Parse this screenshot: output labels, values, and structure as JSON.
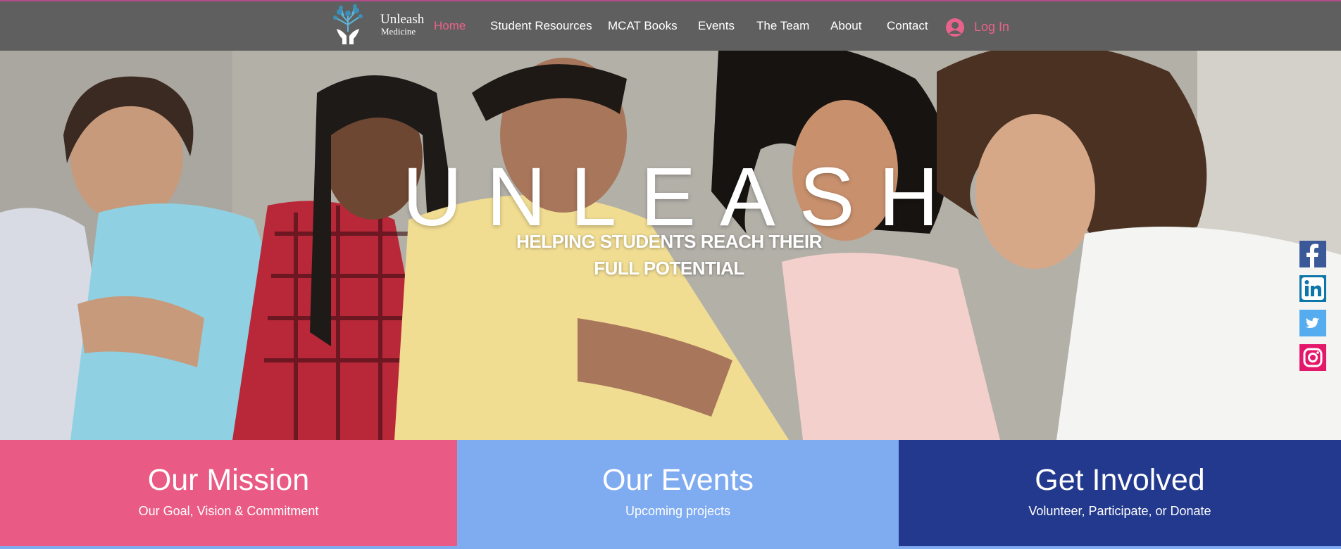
{
  "site": {
    "logo_word": "Unleash",
    "logo_sub": "Medicine"
  },
  "nav": {
    "items": [
      {
        "label": "Home",
        "active": true
      },
      {
        "label": "Student Resources"
      },
      {
        "label": "MCAT Books"
      },
      {
        "label": "Events"
      },
      {
        "label": "The Team"
      },
      {
        "label": "About"
      },
      {
        "label": "Contact"
      }
    ],
    "login_label": "Log In"
  },
  "hero": {
    "title": "UNLEASH",
    "subtitle": "HELPING STUDENTS REACH THEIR FULL POTENTIAL"
  },
  "social": {
    "icons": [
      "facebook-icon",
      "linkedin-icon",
      "twitter-icon",
      "instagram-icon"
    ]
  },
  "panels": [
    {
      "title": "Our Mission",
      "subtitle": "Our Goal, Vision & Commitment",
      "color": "#e95b84"
    },
    {
      "title": "Our Events",
      "subtitle": "Upcoming projects",
      "color": "#7fabf1"
    },
    {
      "title": "Get Involved",
      "subtitle": "Volunteer, Participate, or Donate",
      "color": "#22398d"
    }
  ],
  "colors": {
    "nav_bg": "#5f5f5f",
    "accent_pink": "#e8628b"
  }
}
